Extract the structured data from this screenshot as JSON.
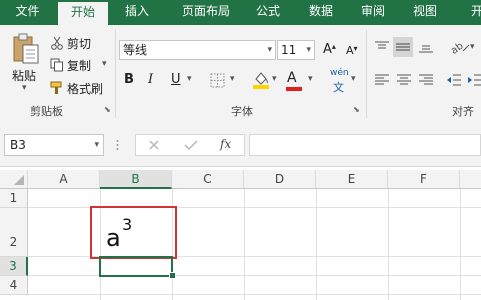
{
  "tabs": [
    "文件",
    "开始",
    "插入",
    "页面布局",
    "公式",
    "数据",
    "审阅",
    "视图",
    "开"
  ],
  "active_tab": "开始",
  "clipboard": {
    "paste": "粘贴",
    "cut": "剪切",
    "copy": "复制",
    "format_painter": "格式刷",
    "group_label": "剪贴板"
  },
  "font": {
    "name": "等线",
    "size": "11",
    "bold": "B",
    "italic": "I",
    "underline": "U",
    "font_color_glyph": "A",
    "wen_glyph": "wén",
    "wen_char": "文",
    "grow": "A",
    "shrink": "A",
    "group_label": "字体"
  },
  "align": {
    "group_label": "对齐方"
  },
  "formula_bar": {
    "name_box": "B3",
    "fx": "fx",
    "value": ""
  },
  "columns": [
    "A",
    "B",
    "C",
    "D",
    "E",
    "F"
  ],
  "rows": [
    "1",
    "2",
    "3",
    "4"
  ],
  "cell_b2": {
    "base": "a",
    "superscript": "3"
  },
  "colors": {
    "accent": "#217346",
    "highlight_border": "#d13438",
    "font_color": "#e0201b",
    "fill_color": "#ffd200"
  }
}
